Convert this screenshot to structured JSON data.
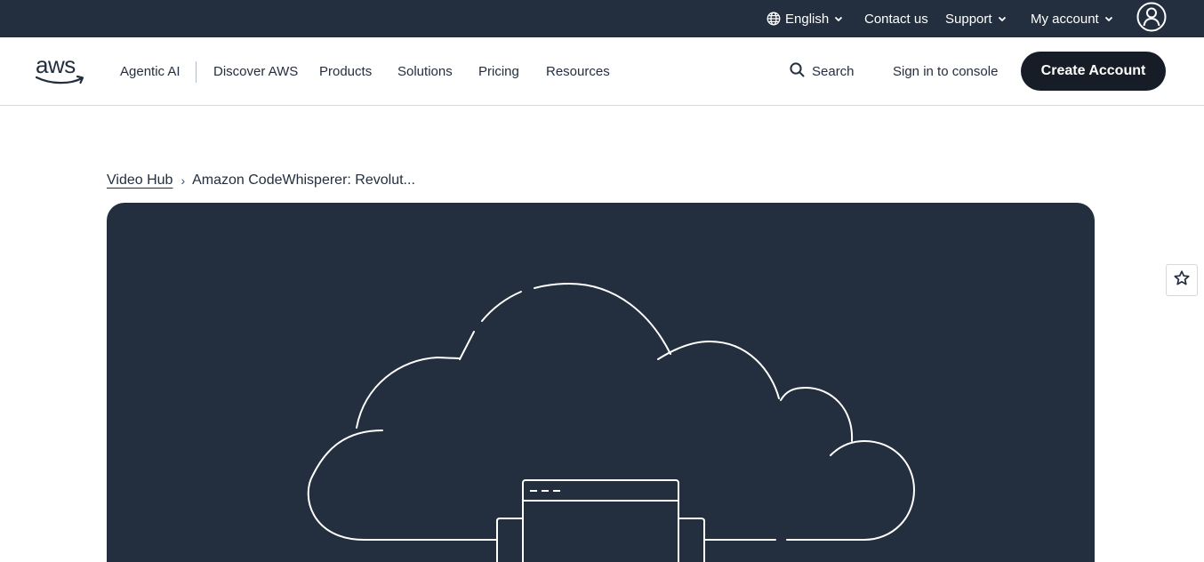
{
  "utility_bar": {
    "language": "English",
    "contact": "Contact us",
    "support": "Support",
    "account": "My account"
  },
  "nav": {
    "items": [
      "Agentic AI",
      "Discover AWS",
      "Products",
      "Solutions",
      "Pricing",
      "Resources"
    ],
    "search": "Search",
    "sign_in": "Sign in to console",
    "create_account": "Create Account"
  },
  "breadcrumb": {
    "parent": "Video Hub",
    "separator": "›",
    "current": "Amazon CodeWhisperer: Revolut..."
  },
  "colors": {
    "utility_bg": "#232f3e",
    "hero_bg": "#232f3e",
    "cta_bg": "#161d26",
    "text": "#232f3e"
  },
  "icons": {
    "language": "globe-icon",
    "dropdown": "chevron-down-icon",
    "profile": "user-avatar-icon",
    "search": "search-icon",
    "favorite": "star-outline-icon",
    "hero": "cloud-illustration"
  }
}
